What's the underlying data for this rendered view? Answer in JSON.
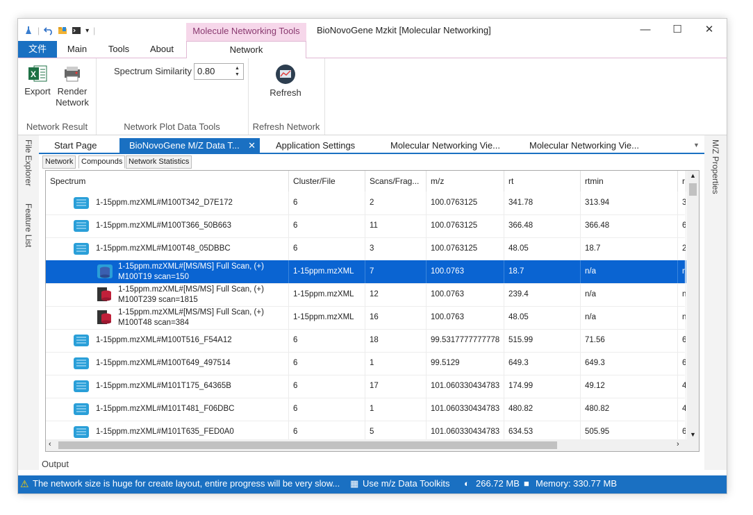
{
  "window": {
    "title": "BioNovoGene Mzkit [Molecular Networking]",
    "context_tab_header": "Molecule Networking Tools",
    "minimize": "—",
    "maximize": "☐",
    "close": "✕"
  },
  "ribbon_tabs": {
    "file": "文件",
    "main": "Main",
    "tools": "Tools",
    "about": "About",
    "network": "Network"
  },
  "ribbon": {
    "export_label": "Export",
    "render_label1": "Render",
    "render_label2": "Network",
    "group1_label": "Network Result",
    "similarity_label": "Spectrum Similarity",
    "similarity_value": "0.80",
    "group2_label": "Network Plot Data Tools",
    "refresh_label": "Refresh",
    "group3_label": "Refresh Network"
  },
  "side_panels": {
    "file_explorer": "File Explorer",
    "feature_list": "Feature List",
    "mz_properties": "M/Z Properties"
  },
  "doc_tabs": [
    "Start Page",
    "BioNovoGene M/Z Data T...",
    "Application Settings",
    "Molecular Networking Vie...",
    "Molecular Networking Vie..."
  ],
  "doc_tab_close": "✕",
  "sub_tabs": [
    "Network",
    "Compounds",
    "Network Statistics"
  ],
  "grid": {
    "columns": [
      "Spectrum",
      "Cluster/File",
      "Scans/Frag...",
      "m/z",
      "rt",
      "rtmin",
      "r"
    ],
    "rows": [
      {
        "spectrum": "1-15ppm.mzXML#M100T342_D7E172",
        "cluster": "6",
        "scans": "2",
        "mz": "100.0763125",
        "rt": "341.78",
        "rtmin": "313.94",
        "extra": "3"
      },
      {
        "spectrum": "1-15ppm.mzXML#M100T366_50B663",
        "cluster": "6",
        "scans": "11",
        "mz": "100.0763125",
        "rt": "366.48",
        "rtmin": "366.48",
        "extra": "6"
      },
      {
        "spectrum": "1-15ppm.mzXML#M100T48_05DBBC",
        "cluster": "6",
        "scans": "3",
        "mz": "100.0763125",
        "rt": "48.05",
        "rtmin": "18.7",
        "extra": "2"
      },
      {
        "spectrum1": "1-15ppm.mzXML#[MS/MS] Full Scan, (+)",
        "spectrum2": "M100T19 scan=150",
        "cluster": "1-15ppm.mzXML",
        "scans": "7",
        "mz": "100.0763",
        "rt": "18.7",
        "rtmin": "n/a",
        "extra": "n"
      },
      {
        "spectrum1": "1-15ppm.mzXML#[MS/MS] Full Scan, (+)",
        "spectrum2": "M100T239 scan=1815",
        "cluster": "1-15ppm.mzXML",
        "scans": "12",
        "mz": "100.0763",
        "rt": "239.4",
        "rtmin": "n/a",
        "extra": "n"
      },
      {
        "spectrum1": "1-15ppm.mzXML#[MS/MS] Full Scan, (+)",
        "spectrum2": "M100T48 scan=384",
        "cluster": "1-15ppm.mzXML",
        "scans": "16",
        "mz": "100.0763",
        "rt": "48.05",
        "rtmin": "n/a",
        "extra": "n"
      },
      {
        "spectrum": "1-15ppm.mzXML#M100T516_F54A12",
        "cluster": "6",
        "scans": "18",
        "mz": "99.5317777777778",
        "rt": "515.99",
        "rtmin": "71.56",
        "extra": "6"
      },
      {
        "spectrum": "1-15ppm.mzXML#M100T649_497514",
        "cluster": "6",
        "scans": "1",
        "mz": "99.5129",
        "rt": "649.3",
        "rtmin": "649.3",
        "extra": "6"
      },
      {
        "spectrum": "1-15ppm.mzXML#M101T175_64365B",
        "cluster": "6",
        "scans": "17",
        "mz": "101.060330434783",
        "rt": "174.99",
        "rtmin": "49.12",
        "extra": "4"
      },
      {
        "spectrum": "1-15ppm.mzXML#M101T481_F06DBC",
        "cluster": "6",
        "scans": "1",
        "mz": "101.060330434783",
        "rt": "480.82",
        "rtmin": "480.82",
        "extra": "4"
      },
      {
        "spectrum": "1-15ppm.mzXML#M101T635_FED0A0",
        "cluster": "6",
        "scans": "5",
        "mz": "101.060330434783",
        "rt": "634.53",
        "rtmin": "505.95",
        "extra": "6"
      }
    ]
  },
  "output_tab": "Output",
  "status": {
    "warning": "The network size is huge for create layout, entire progress will be very slow...",
    "toolkit": "Use m/z Data Toolkits",
    "memory1": "266.72 MB",
    "memory2": "Memory: 330.77 MB"
  },
  "colors": {
    "accent": "#1a70c2",
    "context": "#f6d7ea",
    "selected_row": "#0a64d2"
  }
}
